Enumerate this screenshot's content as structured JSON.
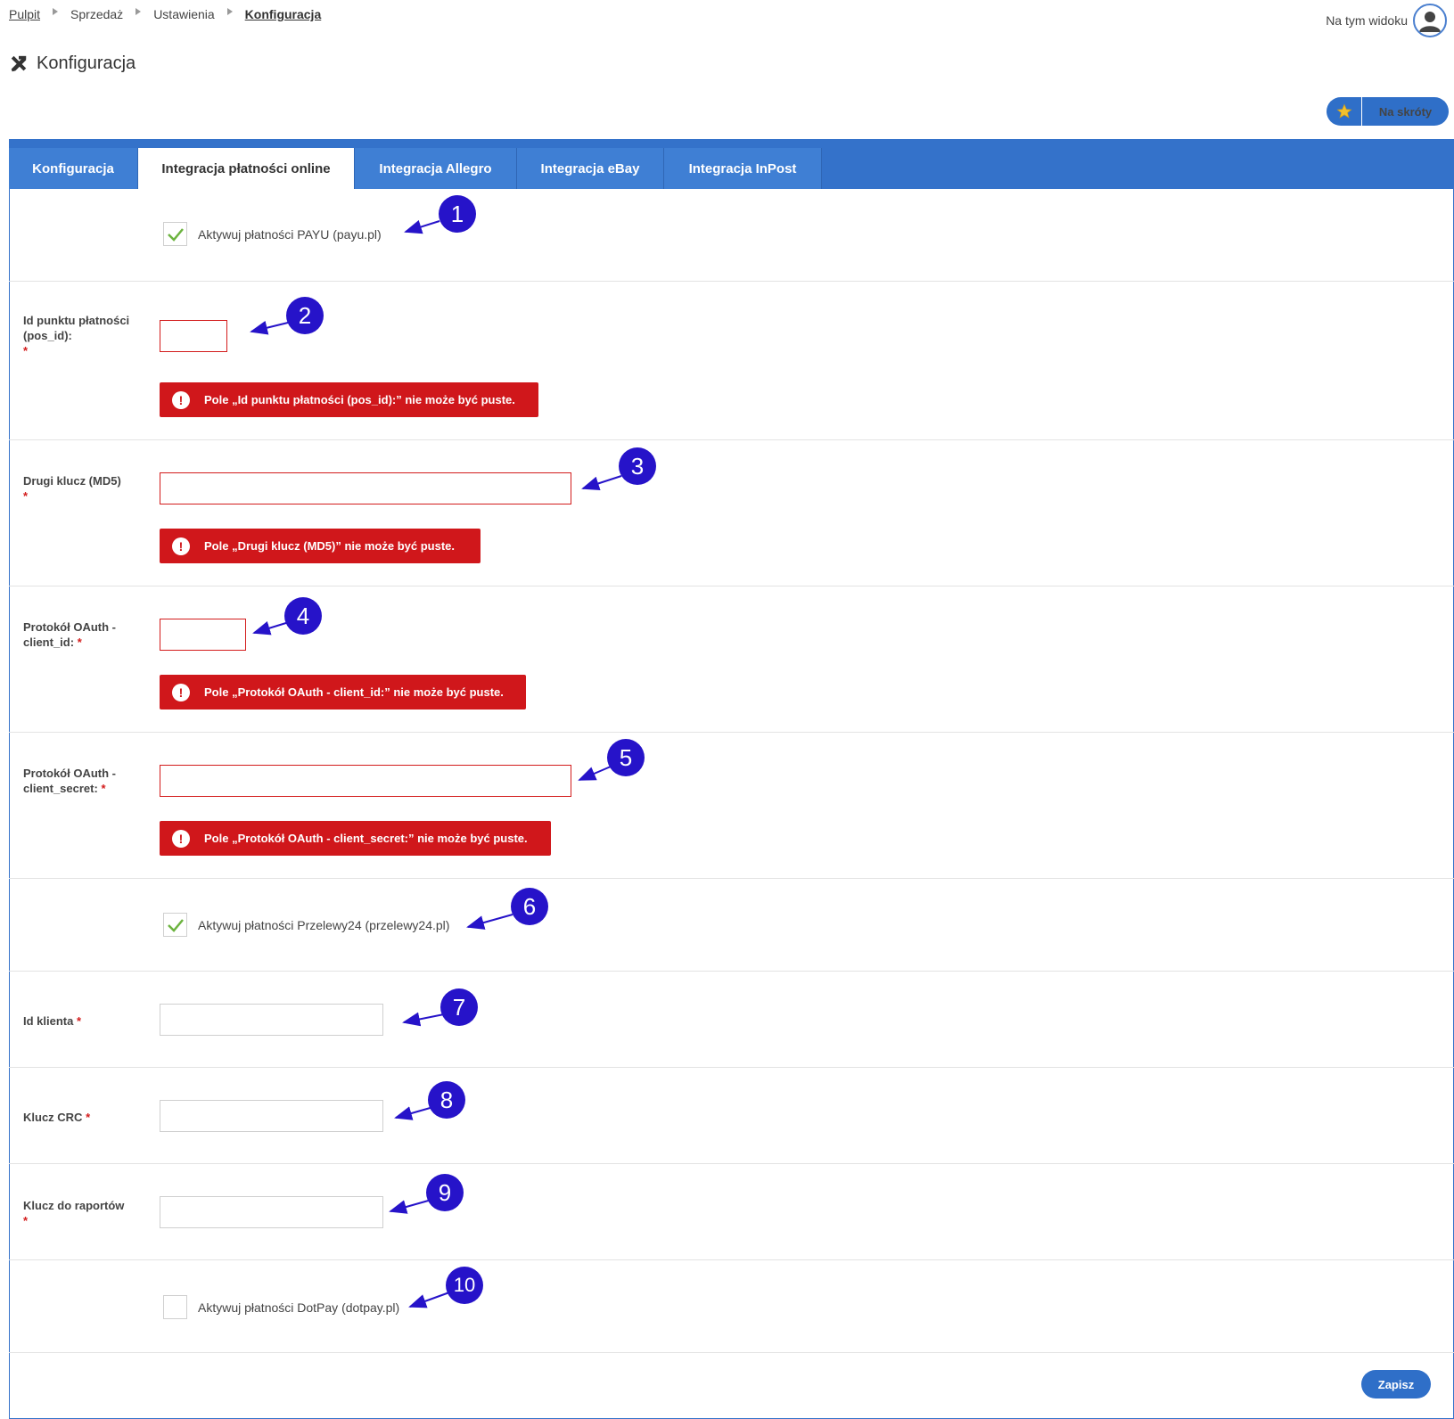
{
  "breadcrumb": [
    "Pulpit",
    "Sprzedaż",
    "Ustawienia",
    "Konfiguracja"
  ],
  "view_user_label": "Na tym widoku",
  "page_title": "Konfiguracja",
  "shortcut_label": "Na skróty",
  "tabs": [
    "Konfiguracja",
    "Integracja płatności online",
    "Integracja Allegro",
    "Integracja eBay",
    "Integracja InPost"
  ],
  "form": {
    "payu_checkbox": {
      "label": "Aktywuj płatności PAYU (payu.pl)",
      "checked": true
    },
    "pos_id": {
      "label": "Id punktu płatności (pos_id):",
      "value": "",
      "error": "Pole „Id punktu płatności (pos_id):” nie może być puste."
    },
    "md5": {
      "label": "Drugi klucz (MD5)",
      "value": "",
      "error": "Pole „Drugi klucz (MD5)” nie może być puste."
    },
    "client_id": {
      "label": "Protokół OAuth - client_id:",
      "value": "",
      "error": "Pole „Protokół OAuth - client_id:” nie może być puste."
    },
    "client_secret": {
      "label": "Protokół OAuth - client_secret:",
      "value": "",
      "error": "Pole „Protokół OAuth - client_secret:” nie może być puste."
    },
    "przelewy24_checkbox": {
      "label": "Aktywuj płatności Przelewy24 (przelewy24.pl)",
      "checked": true
    },
    "id_klienta": {
      "label": "Id klienta",
      "value": ""
    },
    "klucz_crc": {
      "label": "Klucz CRC",
      "value": ""
    },
    "klucz_raportow": {
      "label": "Klucz do raportów",
      "value": ""
    },
    "dotpay_checkbox": {
      "label": "Aktywuj płatności DotPay (dotpay.pl)",
      "checked": false
    }
  },
  "required_mark": "*",
  "error_icon_glyph": "!",
  "callouts": [
    "1",
    "2",
    "3",
    "4",
    "5",
    "6",
    "7",
    "8",
    "9",
    "10"
  ],
  "save_label": "Zapisz",
  "colors": {
    "accent": "#3472ca",
    "error": "#d0171b",
    "callout": "#2613c9",
    "check": "#6cb33f"
  }
}
